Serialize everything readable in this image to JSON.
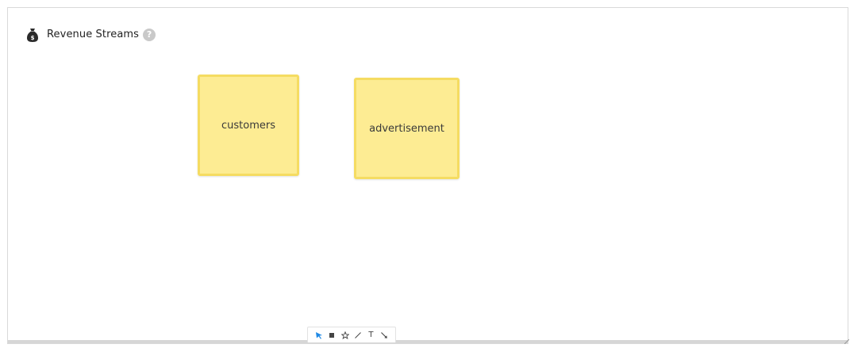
{
  "canvas": {
    "title": "Revenue Streams",
    "title_icon": "money-bag-icon",
    "help_icon": "help-icon",
    "help_glyph": "?"
  },
  "notes": [
    {
      "text": "customers",
      "color": "#fdec93"
    },
    {
      "text": "advertisement",
      "color": "#fdec93"
    }
  ],
  "toolbar": {
    "tools": [
      {
        "name": "select-tool",
        "icon": "cursor-arrow-icon",
        "active": true,
        "accent": "#1e88e5"
      },
      {
        "name": "sticky-note-tool",
        "icon": "square-icon"
      },
      {
        "name": "shape-tool",
        "icon": "star-icon"
      },
      {
        "name": "line-tool",
        "icon": "line-icon"
      },
      {
        "name": "text-tool",
        "icon": "text-icon",
        "glyph": "T"
      },
      {
        "name": "connector-tool",
        "icon": "arrow-icon"
      }
    ]
  }
}
